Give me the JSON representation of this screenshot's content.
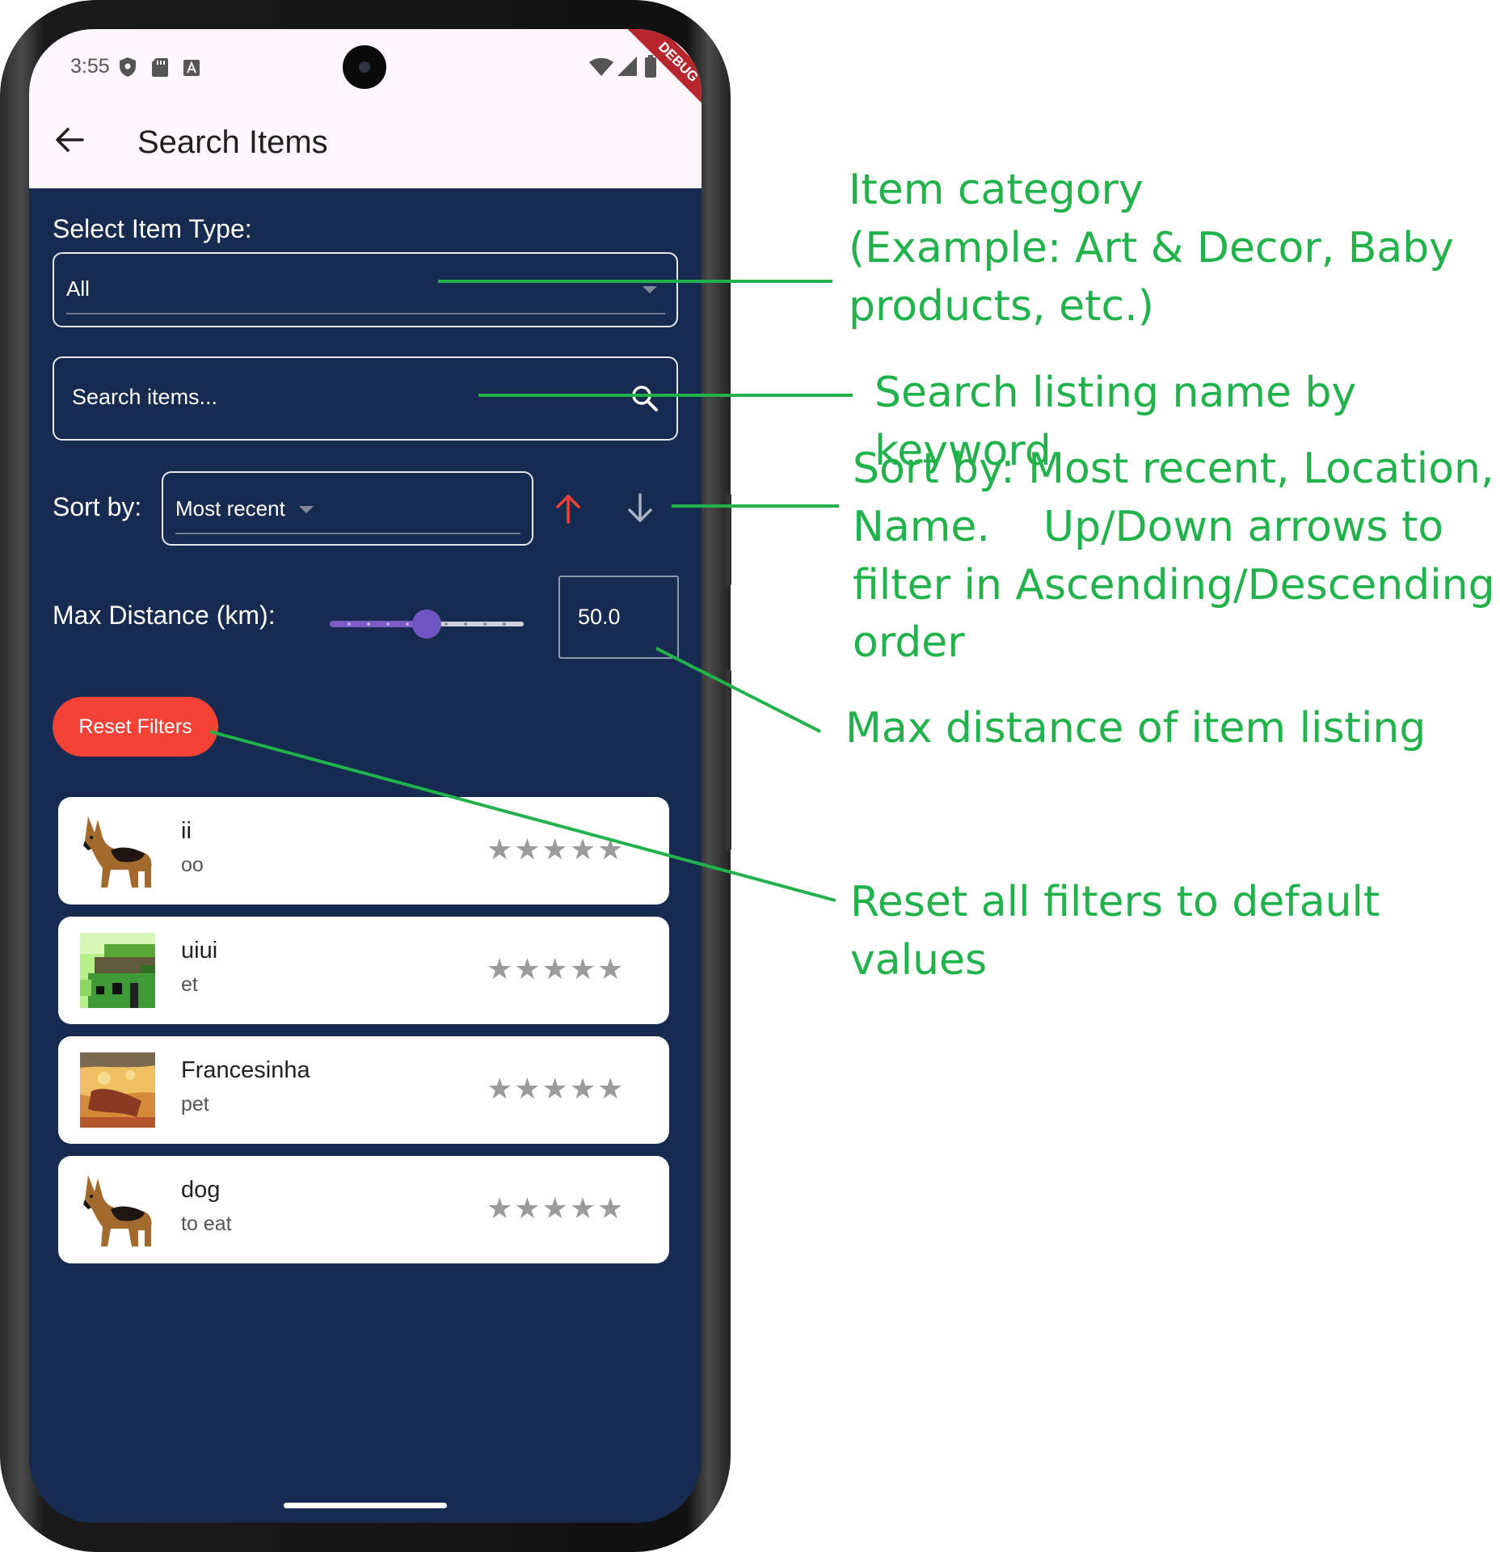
{
  "status_bar": {
    "time": "3:55",
    "debug_label": "DEBUG"
  },
  "app_bar": {
    "title": "Search Items"
  },
  "filters": {
    "item_type_label": "Select Item Type:",
    "item_type_value": "All",
    "search_placeholder": "Search items...",
    "sort_label": "Sort by:",
    "sort_value": "Most recent",
    "distance_label": "Max Distance (km):",
    "distance_value": "50.0",
    "distance_fraction": 0.5,
    "reset_label": "Reset Filters"
  },
  "items": [
    {
      "name": "ii",
      "subtitle": "oo",
      "thumbnail": "german-shepherd-dog",
      "stars": 5
    },
    {
      "name": "uiui",
      "subtitle": "et",
      "thumbnail": "pixel-art-house",
      "stars": 5
    },
    {
      "name": "Francesinha",
      "subtitle": "pet",
      "thumbnail": "francesinha-food",
      "stars": 5
    },
    {
      "name": "dog",
      "subtitle": "to eat",
      "thumbnail": "german-shepherd-dog",
      "stars": 5
    }
  ],
  "annotations": {
    "category_1": "Item category",
    "category_2": "(Example:  Art & Decor, Baby",
    "category_3": "products, etc.)",
    "search": "Search listing name by keyword",
    "sort_1": "Sort by: Most recent, Location,",
    "sort_2": "Name.    Up/Down arrows to",
    "sort_3": "filter in Ascending/Descending",
    "sort_4": "order",
    "distance": "Max distance of item listing",
    "reset": "Reset all filters to default values"
  },
  "colors": {
    "background": "#172a4f",
    "app_bar": "#fdf6fb",
    "accent_red": "#f44336",
    "slider_purple": "#6f55c2",
    "annotation_green": "#22b24c"
  }
}
